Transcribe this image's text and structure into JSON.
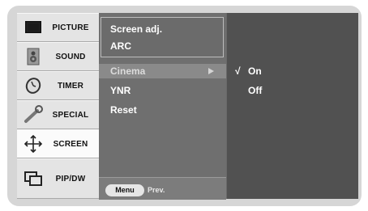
{
  "tabs": [
    {
      "label": "PICTURE",
      "icon": "picture-icon",
      "active": false
    },
    {
      "label": "SOUND",
      "icon": "speaker-icon",
      "active": false
    },
    {
      "label": "TIMER",
      "icon": "clock-icon",
      "active": false
    },
    {
      "label": "SPECIAL",
      "icon": "wrench-icon",
      "active": false
    },
    {
      "label": "SCREEN",
      "icon": "screen-arrows-icon",
      "active": true
    },
    {
      "label": "PIP/DW",
      "icon": "pip-icon",
      "active": false
    }
  ],
  "popup": {
    "items": [
      "Screen adj.",
      "ARC"
    ]
  },
  "menu": {
    "items": [
      "Cinema",
      "YNR",
      "Reset"
    ],
    "selected": "Cinema"
  },
  "options": {
    "items": [
      "On",
      "Off"
    ],
    "checked": "On",
    "check_mark": "√"
  },
  "footer": {
    "menu_label": "Menu",
    "prev_label": "Prev."
  },
  "colors": {
    "osd_background": "#515151",
    "menu_background": "#6f6f6f",
    "tab_background": "#e4e4e4",
    "highlight": "#8a8a8a"
  }
}
